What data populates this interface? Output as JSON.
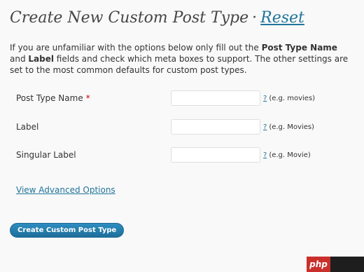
{
  "header": {
    "title": "Create New Custom Post Type",
    "separator": "·",
    "reset_link": "Reset"
  },
  "intro": {
    "part1": "If you are unfamiliar with the options below only fill out the ",
    "bold1": "Post Type Name",
    "part2": " and ",
    "bold2": "Label",
    "part3": " fields and check which meta boxes to support. The other settings are set to the most common defaults for custom post types."
  },
  "form": {
    "fields": [
      {
        "label": "Post Type Name",
        "required_marker": "*",
        "value": "",
        "help_link": "?",
        "example": "(e.g. movies)"
      },
      {
        "label": "Label",
        "value": "",
        "help_link": "?",
        "example": "(e.g. Movies)"
      },
      {
        "label": "Singular Label",
        "value": "",
        "help_link": "?",
        "example": "(e.g. Movie)"
      }
    ],
    "advanced_link": "View Advanced Options",
    "submit_label": "Create Custom Post Type"
  },
  "watermark": {
    "text": "php"
  }
}
